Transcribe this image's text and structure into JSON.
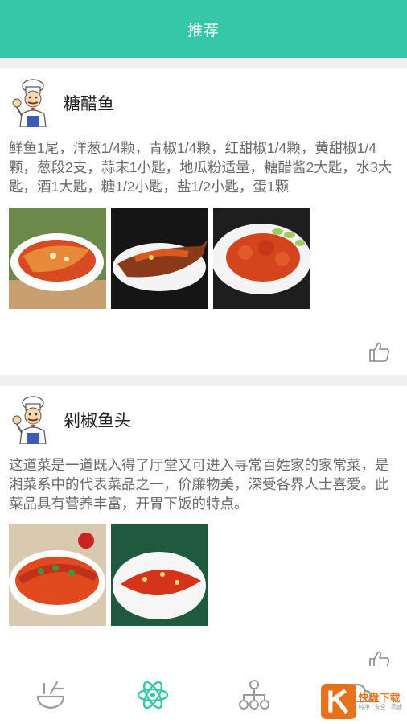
{
  "header": {
    "title": "推荐"
  },
  "recipes": [
    {
      "title": "糖醋鱼",
      "description": "鲜鱼1尾，洋葱1/4颗，青椒1/4颗，红甜椒1/4颗，黄甜椒1/4颗，葱段2支，蒜末1小匙，地瓜粉适量，糖醋酱2大匙，水3大匙，酒1大匙，糖1/2小匙，盐1/2小匙，蛋1颗"
    },
    {
      "title": "剁椒鱼头",
      "description": "这道菜是一道既入得了厅堂又可进入寻常百姓家的家常菜，是湘菜系中的代表菜品之一，价廉物美，深受各界人士喜爱。此菜品具有营养丰富，开胃下饭的特点。"
    }
  ],
  "tabbar": {
    "tabs": [
      {
        "icon": "bowl-icon"
      },
      {
        "icon": "atom-icon",
        "active": true
      },
      {
        "icon": "org-tree-icon"
      },
      {
        "icon": "cloud-icon"
      }
    ],
    "active_color": "#36c6a8",
    "inactive_color": "#9a9a9a"
  },
  "watermark": {
    "main": "快盘下载",
    "sub": "纯净 · 安全 · 高速"
  },
  "colors": {
    "accent": "#36c6a8",
    "text": "#222222",
    "muted": "#6a6a6a"
  }
}
